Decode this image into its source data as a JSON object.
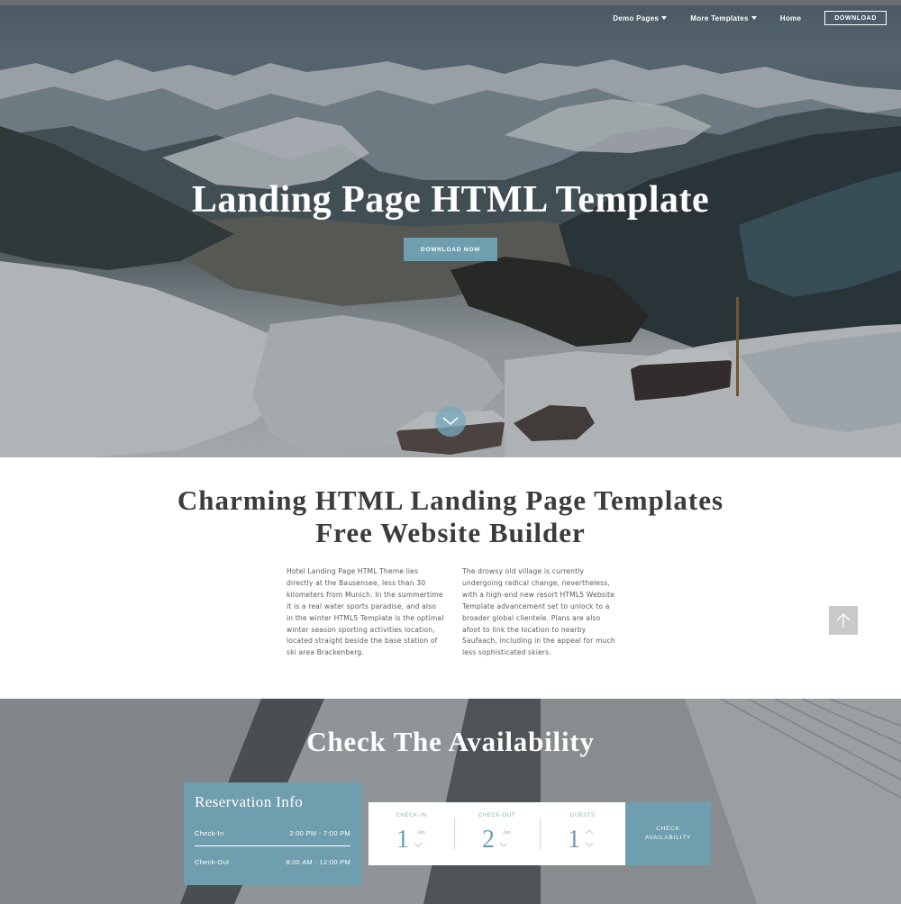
{
  "nav": {
    "items": [
      {
        "label": "Demo Pages",
        "has_dropdown": true
      },
      {
        "label": "More Templates",
        "has_dropdown": true
      },
      {
        "label": "Home",
        "has_dropdown": false
      }
    ],
    "download_label": "DOWNLOAD"
  },
  "hero": {
    "title": "Landing Page HTML Template",
    "cta_label": "DOWNLOAD NOW",
    "scroll_icon": "chevron-down-icon"
  },
  "intro": {
    "title_line1": "Charming HTML Landing Page Templates",
    "title_line2": "Free Website Builder",
    "paragraph_left": "Hotel Landing Page HTML Theme lies directly at the Bausensee, less than 30 kilometers from Munich. In the summertime it is a real water sports paradise, and also in the winter HTML5 Template is the optimal winter season sporting activities location, located straight beside the base station of ski area Brackenberg.",
    "paragraph_right": "The drowsy old village is currently undergoing radical change, nevertheless, with a high-end new resort HTML5 Website Template advancement set to unlock to a broader global clientele. Plans are also afoot to link the location to nearby Saufaach, including in the appeal for much less sophisticated skiers.",
    "to_top_icon": "arrow-up-icon"
  },
  "availability": {
    "title": "Check The Availability",
    "reservation": {
      "title": "Reservation Info",
      "checkin_label": "Check-In",
      "checkin_time": "2:00 PM - 7:00 PM",
      "checkout_label": "Check-Out",
      "checkout_time": "8:00 AM - 12:00 PM"
    },
    "booking": {
      "checkin": {
        "label": "CHECK-IN",
        "value": "1",
        "unit": "Jan"
      },
      "checkout": {
        "label": "CHECK-OUT",
        "value": "2",
        "unit": "Jan"
      },
      "guests": {
        "label": "GUESTS",
        "value": "1"
      }
    },
    "check_button": "CHECK AVAILABILITY"
  },
  "colors": {
    "accent": "#6f9eaf",
    "text_dark": "#3c3c3c",
    "text_body": "#5a5a5a"
  }
}
